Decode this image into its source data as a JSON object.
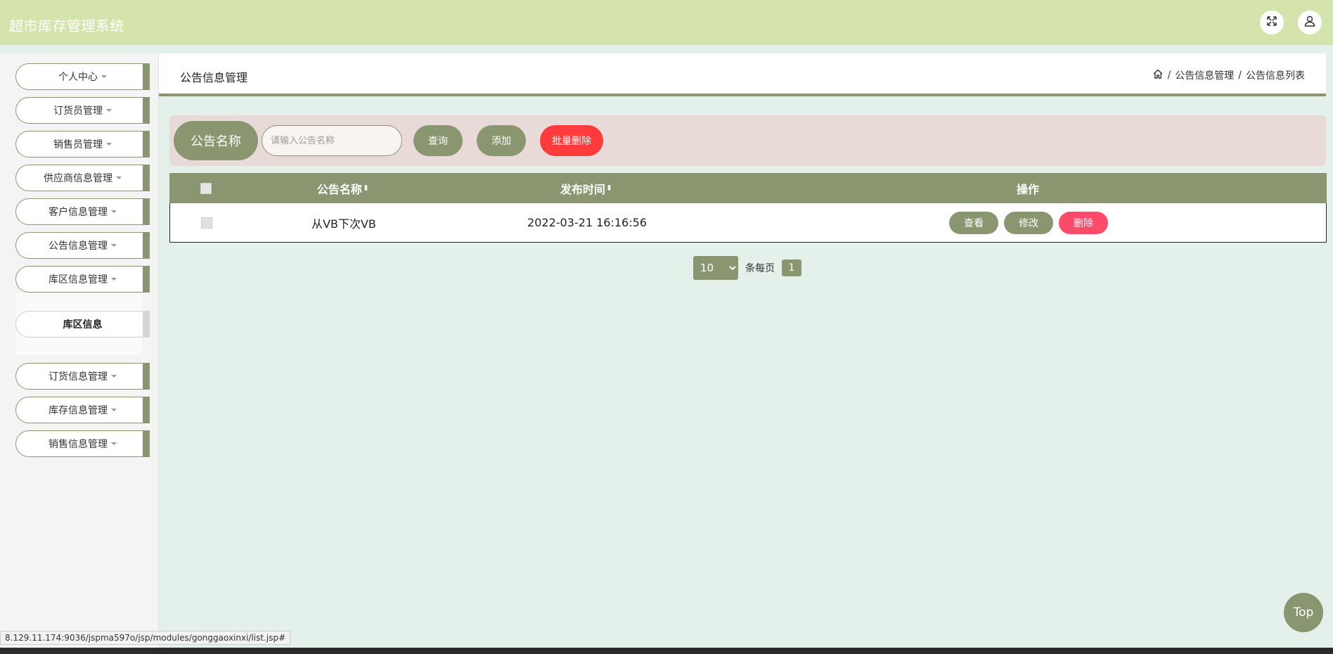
{
  "header": {
    "app_title": "超市库存管理系统",
    "fullscreen_icon": "expand-icon",
    "user_icon": "user-icon"
  },
  "sidebar": {
    "items": [
      {
        "label": "个人中心"
      },
      {
        "label": "订货员管理"
      },
      {
        "label": "销售员管理"
      },
      {
        "label": "供应商信息管理"
      },
      {
        "label": "客户信息管理"
      },
      {
        "label": "公告信息管理"
      },
      {
        "label": "库区信息管理"
      },
      {
        "label": "订货信息管理"
      },
      {
        "label": "库存信息管理"
      },
      {
        "label": "销售信息管理"
      }
    ],
    "submenu_item": "库区信息"
  },
  "page": {
    "title": "公告信息管理",
    "breadcrumb": [
      "公告信息管理",
      "公告信息列表"
    ],
    "breadcrumb_sep": "/"
  },
  "search": {
    "label": "公告名称",
    "placeholder": "请输入公告名称",
    "query_button": "查询",
    "add_button": "添加",
    "batch_delete_button": "批量删除"
  },
  "table": {
    "headers": {
      "name": "公告名称",
      "time": "发布时间",
      "actions": "操作"
    },
    "sort_glyph": "⬍",
    "rows": [
      {
        "name": "从VB下次VB",
        "time": "2022-03-21 16:16:56"
      }
    ],
    "actions": {
      "view": "查看",
      "edit": "修改",
      "delete": "删除"
    }
  },
  "pagination": {
    "page_size": "10",
    "per_page_label": "条每页",
    "current_page": "1"
  },
  "top_button": "Top",
  "status_url": "8.129.11.174:9036/jspma597o/jsp/modules/gonggaoxinxi/list.jsp#",
  "colors": {
    "header_bg": "#d4e4ac",
    "accent": "#8a9670",
    "danger": "#ff3b3b",
    "danger_alt": "#ff4a6a",
    "content_bg": "#e4f0ea",
    "search_bg": "#e8dbd7"
  }
}
